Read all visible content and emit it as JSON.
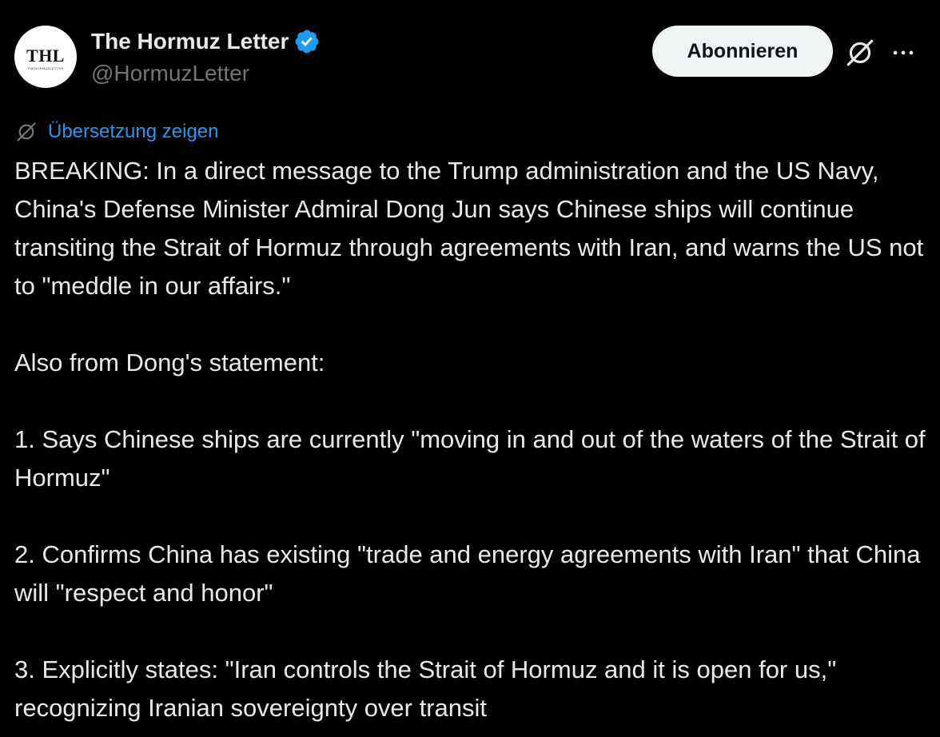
{
  "author": {
    "avatar_text": "THL",
    "avatar_subtext": "THEHORMUZLETTER",
    "display_name": "The Hormuz Letter",
    "handle": "@HormuzLetter",
    "verified_icon": "verified-badge-icon"
  },
  "actions": {
    "subscribe_label": "Abonnieren",
    "grok_icon": "grok-icon",
    "more_icon": "more-icon"
  },
  "translate": {
    "icon": "grok-translate-icon",
    "label": "Übersetzung zeigen"
  },
  "tweet": {
    "paragraphs": [
      "BREAKING: In a direct message to the Trump administration and the US Navy, China's Defense Minister Admiral Dong Jun says Chinese ships will continue transiting the Strait of Hormuz through agreements with Iran, and warns the US not to \"meddle in our affairs.\"",
      "Also from Dong's statement:",
      "1. Says Chinese ships are currently \"moving in and out of the waters of the Strait of Hormuz\"",
      "2. Confirms China has existing \"trade and energy agreements with Iran\" that China will \"respect and honor\"",
      "3. Explicitly states: \"Iran controls the Strait of Hormuz and it is open for us,\" recognizing Iranian sovereignty over transit"
    ]
  },
  "colors": {
    "background": "#000000",
    "text": "#e7e9ea",
    "secondary": "#71767b",
    "link": "#1d9bf0",
    "verified": "#1d9bf0",
    "button_bg": "#eff3f4"
  }
}
